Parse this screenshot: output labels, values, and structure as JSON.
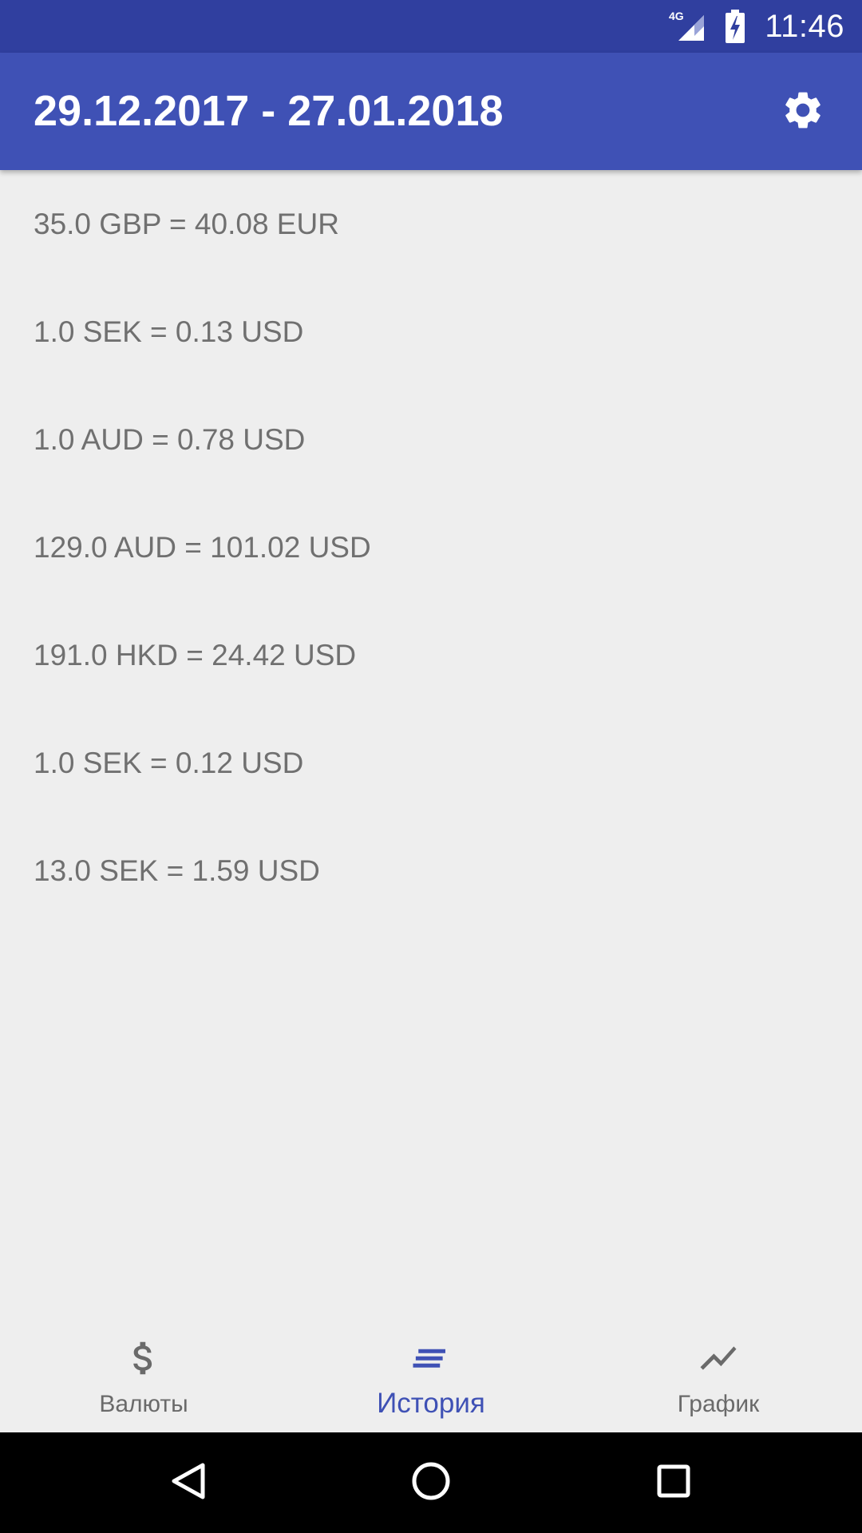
{
  "status_bar": {
    "network": "4G",
    "time": "11:46"
  },
  "app_bar": {
    "title": "29.12.2017 - 27.01.2018",
    "settings_icon": "gear-icon"
  },
  "history": [
    "35.0 GBP = 40.08 EUR",
    "1.0 SEK = 0.13 USD",
    "1.0 AUD = 0.78 USD",
    "129.0 AUD = 101.02 USD",
    "191.0 HKD = 24.42 USD",
    "1.0 SEK = 0.12 USD",
    "13.0 SEK = 1.59 USD"
  ],
  "bottom_nav": {
    "items": [
      {
        "label": "Валюты",
        "icon": "dollar-icon",
        "active": false
      },
      {
        "label": "История",
        "icon": "list-icon",
        "active": true
      },
      {
        "label": "График",
        "icon": "trending-icon",
        "active": false
      }
    ]
  },
  "colors": {
    "primary": "#3f51b5",
    "primary_dark": "#303f9f",
    "background": "#eeeeee",
    "text_secondary": "#707070"
  }
}
